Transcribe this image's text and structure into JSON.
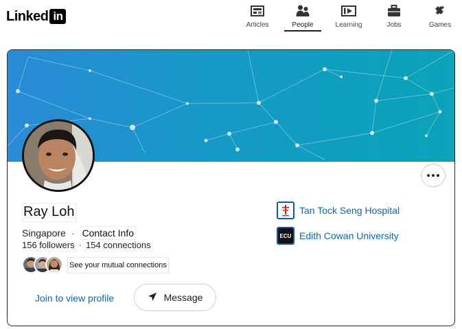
{
  "brand": {
    "logo_text": "Linked",
    "logo_box": "in"
  },
  "nav": [
    {
      "label": "Articles",
      "icon": "articles-icon"
    },
    {
      "label": "People",
      "icon": "people-icon",
      "active": true
    },
    {
      "label": "Learning",
      "icon": "learning-icon"
    },
    {
      "label": "Jobs",
      "icon": "briefcase-icon"
    },
    {
      "label": "Games",
      "icon": "puzzle-icon"
    }
  ],
  "profile": {
    "name": "Ray Loh",
    "location": "Singapore",
    "separator": "·",
    "contact_info": "Contact Info",
    "followers": "156 followers",
    "connections": "154 connections",
    "mutual_label": "See your mutual connections",
    "more_label": "More actions"
  },
  "organizations": [
    {
      "name": "Tan Tock Seng Hospital",
      "logo": "ttsh-logo"
    },
    {
      "name": "Edith Cowan University",
      "logo": "ecu-logo",
      "logo_text": "ECU"
    }
  ],
  "actions": {
    "join_label": "Join to view profile",
    "message_label": "Message"
  },
  "colors": {
    "link": "#0a66c2",
    "banner_start": "#2a8bd6",
    "banner_end": "#0aa3b8",
    "text": "#191919"
  }
}
